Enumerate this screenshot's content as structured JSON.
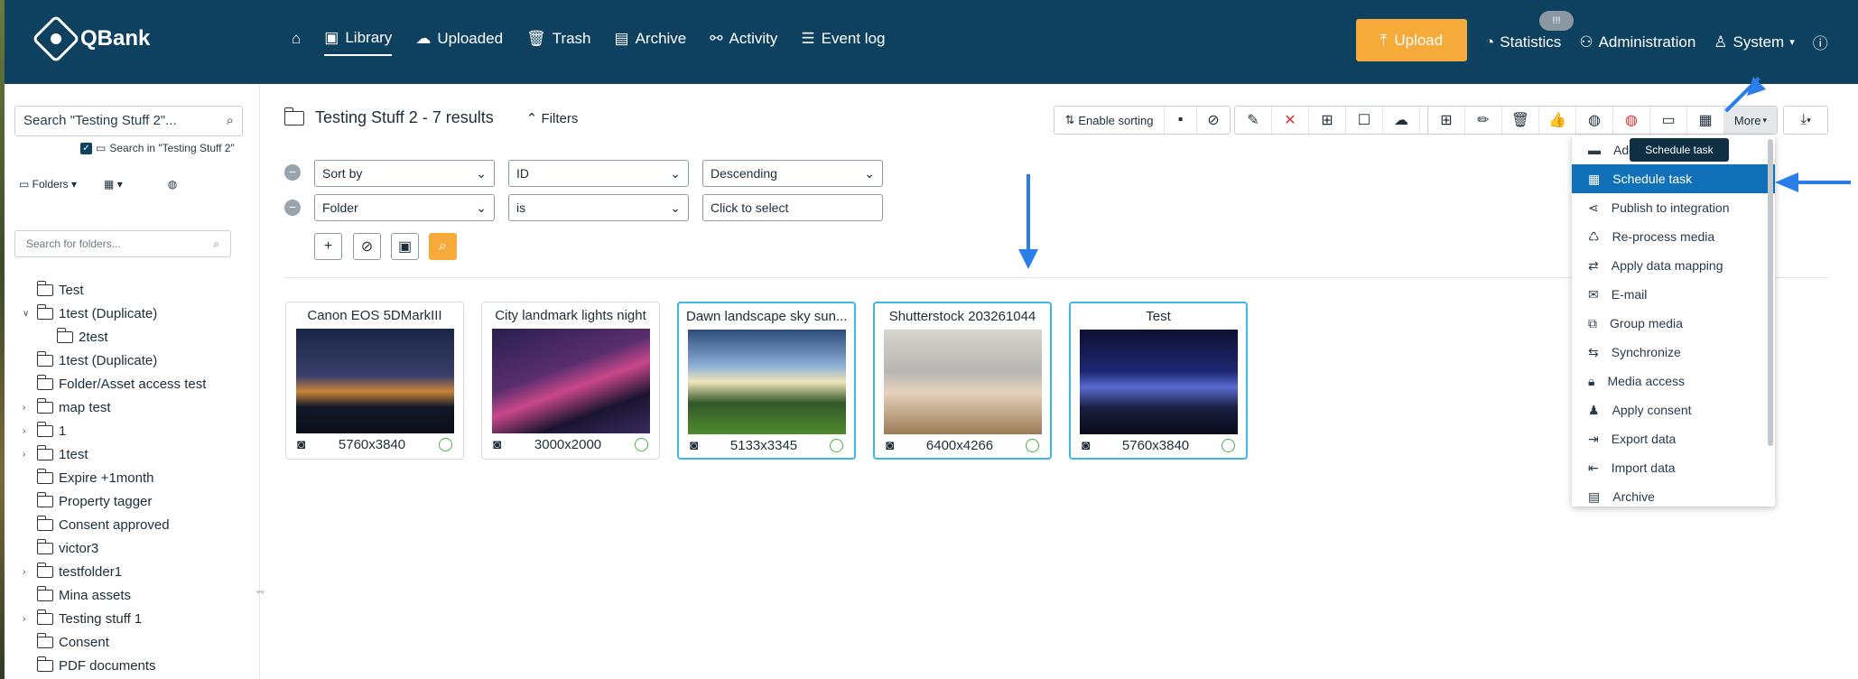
{
  "nav": {
    "logo": "QBank",
    "items": [
      "Library",
      "Uploaded",
      "Trash",
      "Archive",
      "Activity",
      "Event log"
    ],
    "upload": "Upload",
    "statistics": "Statistics",
    "administration": "Administration",
    "system": "System",
    "badge": "!!!"
  },
  "sidebar": {
    "search": "Search \"Testing Stuff 2\"...",
    "search_in": "Search in \"Testing Stuff 2\"",
    "folders_label": "Folders",
    "folder_search_placeholder": "Search for folders...",
    "tree": [
      "Test",
      "1test (Duplicate)",
      "2test",
      "1test (Duplicate)",
      "Folder/Asset access test",
      "map test",
      "1",
      "1test",
      "Expire +1month",
      "Property tagger",
      "Consent approved",
      "victor3",
      "testfolder1",
      "Mina assets",
      "Testing stuff 1",
      "Consent",
      "PDF documents"
    ]
  },
  "main": {
    "title": "Testing Stuff 2 - 7 results",
    "filters": "Filters",
    "enable_sorting": "Enable sorting",
    "more": "More",
    "sort": {
      "field": "Sort by",
      "value": "ID",
      "order": "Descending"
    },
    "filter": {
      "field": "Folder",
      "op": "is",
      "value": "Click to select"
    }
  },
  "cards": [
    {
      "title": "Canon EOS 5DMarkIII",
      "dims": "5760x3840"
    },
    {
      "title": "City landmark lights night",
      "dims": "3000x2000"
    },
    {
      "title": "Dawn landscape sky sun...",
      "dims": "5133x3345"
    },
    {
      "title": "Shutterstock 203261044",
      "dims": "6400x4266"
    },
    {
      "title": "Test",
      "dims": "5760x3840"
    }
  ],
  "menu": {
    "tooltip": "Schedule task",
    "items": [
      "Add to lightbox",
      "Schedule task",
      "Publish to integration",
      "Re-process media",
      "Apply data mapping",
      "E-mail",
      "Group media",
      "Synchronize",
      "Media access",
      "Apply consent",
      "Export data",
      "Import data",
      "Archive"
    ]
  },
  "colors": {
    "topbar": "#0e4160",
    "upload": "#f6aa3a",
    "highlight": "#1171b8",
    "selected_card": "#3bb7e8",
    "annotation": "#2b7de9"
  }
}
